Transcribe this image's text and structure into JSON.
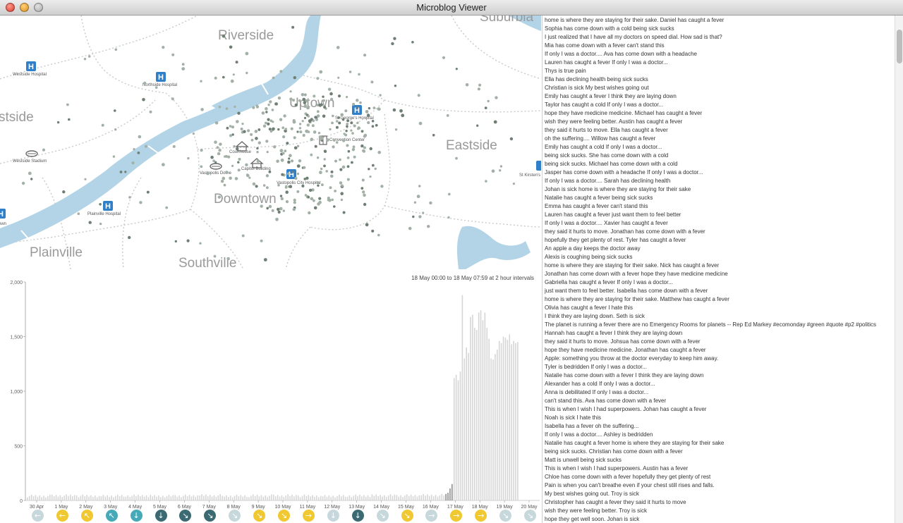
{
  "window": {
    "title": "Microblog Viewer"
  },
  "map": {
    "districts": [
      "Riverside",
      "Uptown",
      "Eastside",
      "Downtown",
      "Plainville",
      "Southville",
      "Suburbia",
      "stside"
    ],
    "places": [
      "Westside Hospital",
      "Northside Hospital",
      "St George's Hospital",
      "Courthouse",
      "Convention Center",
      "Westside Stadium",
      "Vastopolis Dome",
      "Capitol Building",
      "Vastopolis City Hospital",
      "Plainville Hospital",
      "St Kirsten's",
      "own"
    ],
    "colors": {
      "water": "#b3d4e6",
      "road": "#c8c8c8",
      "dot": "#8a9a8e",
      "hospital": "#2f7fc9"
    }
  },
  "chart": {
    "caption": "18 May 00:00 to 18 May 07:59 at 2 hour intervals"
  },
  "chart_data": {
    "type": "bar",
    "ylim": [
      0,
      2000
    ],
    "yticks": [
      "0",
      "500",
      "1,000",
      "1,500",
      "2,000"
    ],
    "xticks": [
      "30 Apr",
      "1 May",
      "2 May",
      "3 May",
      "4 May",
      "5 May",
      "6 May",
      "7 May",
      "8 May",
      "9 May",
      "10 May",
      "11 May",
      "12 May",
      "13 May",
      "14 May",
      "15 May",
      "16 May",
      "17 May",
      "18 May",
      "19 May",
      "20 May"
    ],
    "highlight": "18 May 00:00 to 18 May 07:59",
    "daily_baseline": [
      40,
      44,
      42,
      41,
      43,
      40,
      42,
      45,
      41,
      43,
      44,
      42,
      40,
      43,
      45,
      44,
      47
    ],
    "day18": [
      60,
      70,
      110,
      150,
      1120,
      1150,
      1100,
      1180,
      1880,
      1300,
      1400,
      1350
    ],
    "day19": [
      1680,
      1700,
      1580,
      1560,
      1720,
      1740,
      1650,
      1720,
      1580,
      1480,
      1300,
      1290
    ],
    "day20": [
      1340,
      1380,
      1460,
      1440,
      1500,
      1490,
      1470,
      1520,
      1430,
      1460,
      1440,
      1450
    ]
  },
  "weather": [
    {
      "dir": "←",
      "color": "#c7d8dc"
    },
    {
      "dir": "←",
      "color": "#f0c832"
    },
    {
      "dir": "↖",
      "color": "#f0c832"
    },
    {
      "dir": "↖",
      "color": "#45a9b8"
    },
    {
      "dir": "↓",
      "color": "#45a9b8"
    },
    {
      "dir": "↓",
      "color": "#3c6a72"
    },
    {
      "dir": "↘",
      "color": "#3c6a72"
    },
    {
      "dir": "↘",
      "color": "#3c6a72"
    },
    {
      "dir": "↘",
      "color": "#c7d8dc"
    },
    {
      "dir": "↘",
      "color": "#f0c832"
    },
    {
      "dir": "↘",
      "color": "#f0c832"
    },
    {
      "dir": "→",
      "color": "#f0c832"
    },
    {
      "dir": "↓",
      "color": "#c7d8dc"
    },
    {
      "dir": "↓",
      "color": "#3c6a72"
    },
    {
      "dir": "↘",
      "color": "#c7d8dc"
    },
    {
      "dir": "↘",
      "color": "#f0c832"
    },
    {
      "dir": "→",
      "color": "#c7d8dc"
    },
    {
      "dir": "→",
      "color": "#f0c832"
    },
    {
      "dir": "→",
      "color": "#f0c832"
    },
    {
      "dir": "↘",
      "color": "#c7d8dc"
    },
    {
      "dir": "↘",
      "color": "#c7d8dc"
    }
  ],
  "feed": [
    "home is where they are staying for their sake. Daniel has caught a fever",
    "Sophia has come down with a cold being sick sucks",
    "I just realized that I have all my doctors on speed dial.  How sad is that?",
    "Mia has come down with a fever can't stand this",
    "If only I was a doctor.... Ava has come down with a headache",
    "Lauren has caught a fever If only I was a doctor...",
    "Thys is true pain",
    "Ella has declining health being sick sucks",
    "Christian is sick My best wishes going out",
    "Emily has caught a fever I think they are laying down",
    "Taylor has caught a cold If only I was a doctor...",
    "hope they have medicine medicine. Michael has caught a fever",
    "wish they were feeling better. Austin has caught a fever",
    "they said it hurts to move. Ella has caught a fever",
    "oh the suffering.... Willow has caught a fever",
    "Emily has caught a cold If only I was a doctor...",
    "being sick sucks. She has come down with a cold",
    "being sick sucks. Michael has come down with a cold",
    "Jasper has come down with a headache If only I was a doctor...",
    "If only I was a doctor.... Sarah has declining health",
    "Johan is sick home is where they are staying for their sake",
    "Natalie has caught a fever being sick sucks",
    "Emma has caught a fever can't stand this",
    "Lauren has caught a fever just want them to feel better",
    "If only I was a doctor.... Xavier has caught a fever",
    "they said it hurts to move. Jonathan has come down with a fever",
    "hopefully they get plenty of rest. Tyler has caught a fever",
    "An apple a day keeps the doctor away",
    "Alexis is coughing being sick sucks",
    "home is where they are staying for their sake. Nick has caught a fever",
    "Jonathan has come down with a fever hope they have medicine medicine",
    "Gabriella has caught a fever If only I was a doctor...",
    "just want them to feel better. Isabella has come down with a fever",
    "home is where they are staying for their sake. Matthew has caught a fever",
    "Olivia has caught a fever I hate this",
    "I think they are laying down. Seth is sick",
    "The planet is running a fever there are no Emergency Rooms for planets -- Rep Ed Markey #ecomonday #green #quote #p2 #politics",
    "Hannah has caught a fever I think they are laying down",
    "they said it hurts to move. Johsua has come down with a fever",
    "hope they have medicine medicine. Jonathan has caught a fever",
    "Apple:  something you throw at the doctor everyday to keep him away.",
    "Tyler is bedridden If only I was a doctor...",
    "Natalie has come down with a fever I think they are laying down",
    "Alexander has a cold If only I was a doctor...",
    "Anna is debilitated If only I was a doctor...",
    "can't stand this. Ava has come down with a fever",
    "This is when I wish I had superpowers. Johan has caught a fever",
    "Noah is sick I hate this",
    "Isabella has a fever oh the suffering...",
    "If only I was a doctor.... Ashley is bedridden",
    "Natalie has caught a fever home is where they are staying for their sake",
    "being sick sucks. Christian has come down with a fever",
    "Matt is unwell being sick sucks",
    "This is when I wish I had superpowers. Austin has a fever",
    "Chloe has come down with a fever hopefully they get plenty of rest",
    "Pain is when you can't breathe even if your chest still rises and falls.",
    "My best wishes going out. Troy is sick",
    "Christopher has caught a fever they said it hurts to move",
    "wish they were feeling better. Troy is sick",
    "hope they get well soon. Johan is sick"
  ]
}
